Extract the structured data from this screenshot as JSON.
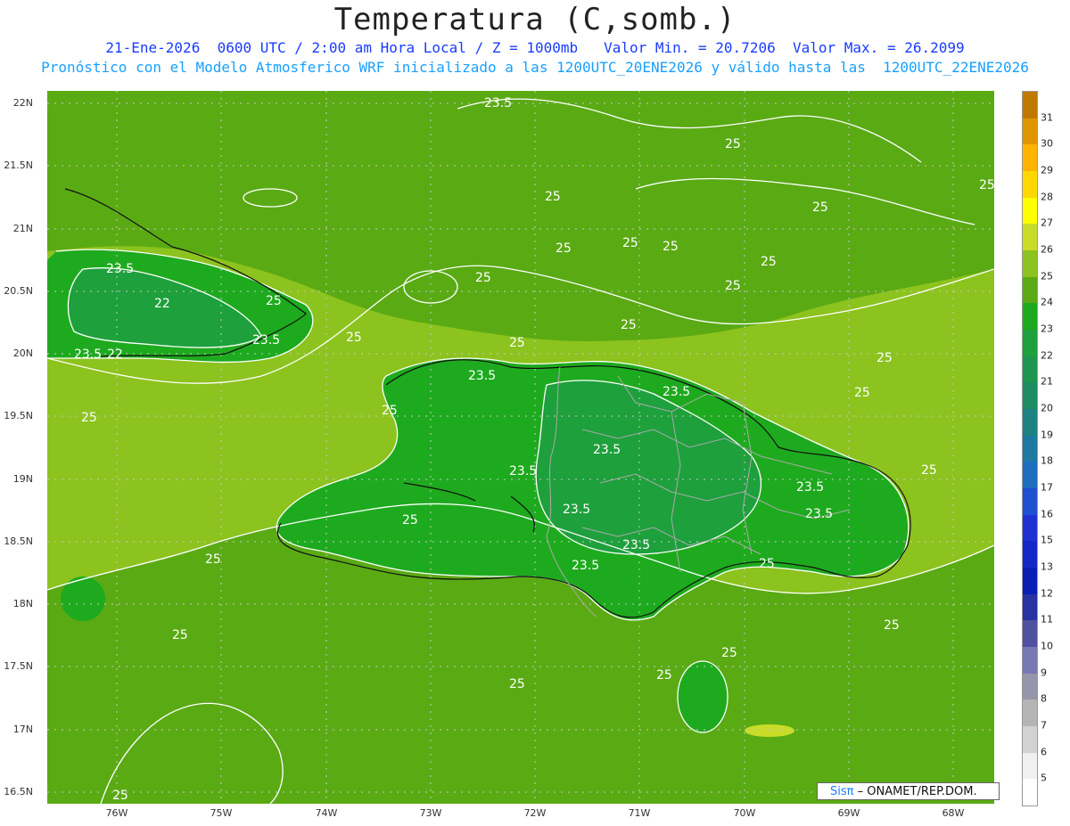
{
  "title": "Temperatura (C,somb.)",
  "subtitle_line1": "21-Ene-2026  0600 UTC / 2:00 am Hora Local / Z = 1000mb   Valor Min. = 20.7206  Valor Max. = 26.2099",
  "subtitle_line2": "Pronóstico con el Modelo Atmosferico WRF inicializado a las 1200UTC_20ENE2026 y válido hasta las  1200UTC_22ENE2026",
  "lat_labels": [
    "22N",
    "21.5N",
    "21N",
    "20.5N",
    "20N",
    "19.5N",
    "19N",
    "18.5N",
    "18N",
    "17.5N",
    "17N",
    "16.5N"
  ],
  "lon_labels": [
    "76W",
    "75W",
    "74W",
    "73W",
    "72W",
    "71W",
    "70W",
    "69W",
    "68W"
  ],
  "colorbar": {
    "levels": [
      "31",
      "30",
      "29",
      "28",
      "27",
      "26",
      "25",
      "24",
      "23",
      "22",
      "21",
      "20",
      "19",
      "18",
      "17",
      "16",
      "15",
      "13",
      "12",
      "11",
      "10",
      "9",
      "8",
      "7",
      "6",
      "5"
    ],
    "colors": [
      "#c07800",
      "#e09600",
      "#ffb400",
      "#ffd800",
      "#ffff00",
      "#c8dc28",
      "#8cc31e",
      "#5aaa14",
      "#1eaa1e",
      "#1ea03c",
      "#1e9650",
      "#1e8c64",
      "#1e8282",
      "#1e78a0",
      "#1e6ebe",
      "#1e50d2",
      "#1e32d2",
      "#1428c8",
      "#0a1eb4",
      "#2832a0",
      "#5050a0",
      "#7878b4",
      "#9696aa",
      "#b4b4b4",
      "#d2d2d2",
      "#f0f0f0"
    ]
  },
  "contour_labels": [
    "23.5",
    "25",
    "23.5",
    "22",
    "23.5",
    "23.5",
    "22",
    "25",
    "25",
    "25",
    "25",
    "25",
    "25",
    "25",
    "25",
    "25",
    "25",
    "25",
    "25",
    "25",
    "25",
    "25",
    "23.5",
    "23.5",
    "23.5",
    "23.5",
    "23.5",
    "23.5",
    "23.5",
    "23.5",
    "23.5",
    "25",
    "25",
    "25",
    "25",
    "25",
    "25",
    "25",
    "25",
    "25",
    "25",
    "25",
    "25"
  ],
  "credit": {
    "sis": "Sisπ",
    "rest": " – ONAMET/REP.DOM."
  }
}
